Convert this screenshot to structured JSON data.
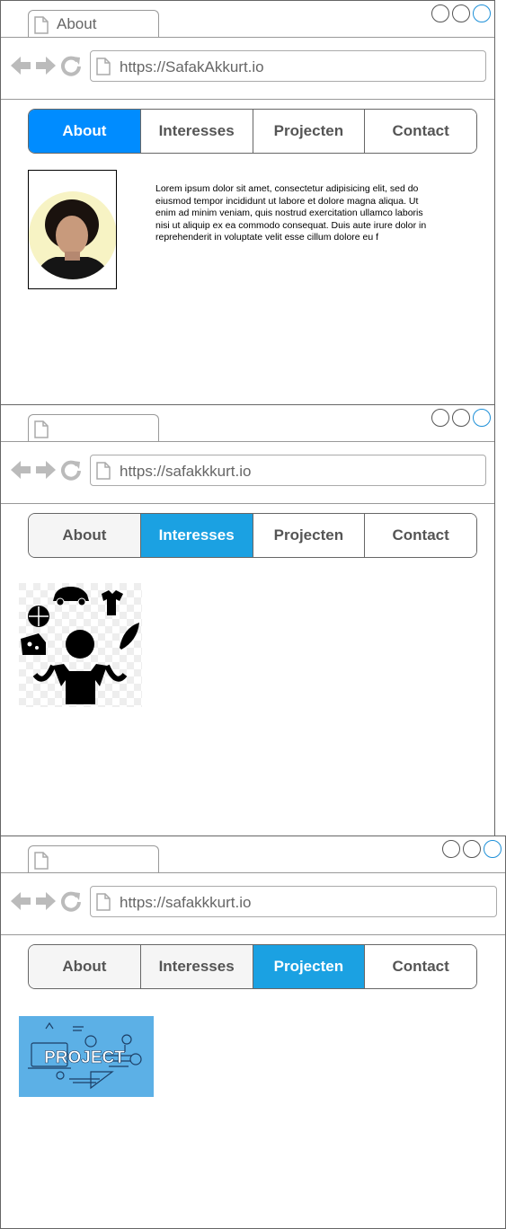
{
  "windows": [
    {
      "tab_title": "About",
      "url": "https://SafakAkkurt.io",
      "menu": [
        "About",
        "Interesses",
        "Projecten",
        "Contact"
      ],
      "active": "About",
      "content_text": "Lorem ipsum dolor sit amet, consectetur adipisicing elit, sed do eiusmod tempor incididunt ut labore et dolore magna aliqua. Ut enim ad minim veniam, quis nostrud exercitation ullamco laboris nisi ut aliquip ex ea commodo consequat. Duis aute irure dolor in reprehenderit in voluptate velit esse cillum dolore eu f"
    },
    {
      "tab_title": "",
      "url": "https://safakkkurt.io",
      "menu": [
        "About",
        "Interesses",
        "Projecten",
        "Contact"
      ],
      "active": "Interesses"
    },
    {
      "tab_title": "",
      "url": "https://safakkkurt.io",
      "menu": [
        "About",
        "Interesses",
        "Projecten",
        "Contact"
      ],
      "active": "Projecten",
      "banner_text": "PROJECT"
    }
  ],
  "colors": {
    "active_about": "#008cff",
    "active_other": "#1ba1e2",
    "window_button_accent": "#1e90d8",
    "project_banner": "#5cb0e6"
  },
  "icons": [
    "document-icon",
    "back-arrow-icon",
    "forward-arrow-icon",
    "refresh-icon",
    "window-circle-icon"
  ]
}
